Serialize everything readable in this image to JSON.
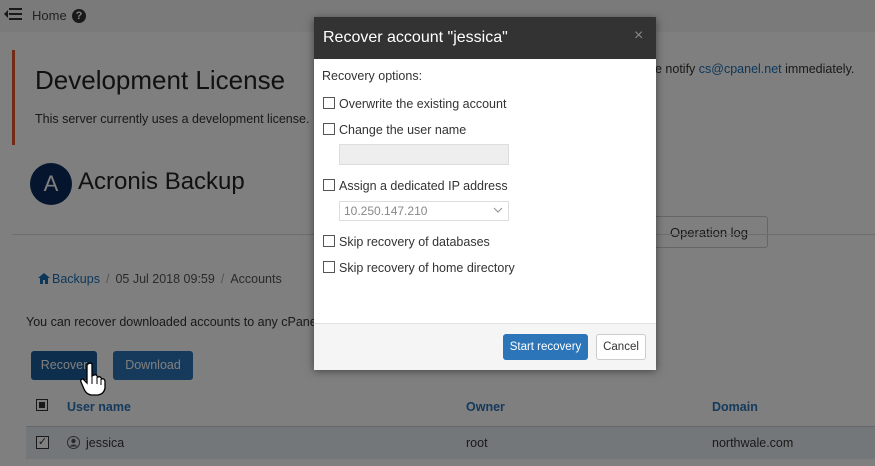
{
  "topbar": {
    "home_label": "Home",
    "help_glyph": "?"
  },
  "license": {
    "title": "Development License",
    "text_left": "This server currently uses a development license. I",
    "text_right_prefix": "e notify ",
    "email": "cs@cpanel.net",
    "text_right_suffix": " immediately."
  },
  "plugin": {
    "logo_letter": "A",
    "title": "Acronis Backup"
  },
  "toolbar": {
    "operation_log_label": "Operation log"
  },
  "breadcrumb": {
    "backups": "Backups",
    "date": "05 Jul 2018 09:59",
    "accounts": "Accounts"
  },
  "info_text": "You can recover downloaded accounts to any cPane",
  "actions": {
    "recover_label": "Recover",
    "download_label": "Download"
  },
  "table": {
    "headers": {
      "user": "User name",
      "owner": "Owner",
      "domain": "Domain"
    },
    "rows": [
      {
        "user": "jessica",
        "owner": "root",
        "domain": "northwale.com",
        "checked": "✓"
      }
    ]
  },
  "modal": {
    "title": "Recover account \"jessica\"",
    "close_glyph": "×",
    "options_label": "Recovery options:",
    "options": [
      "Overwrite the existing account",
      "Change the user name",
      "Assign a dedicated IP address",
      "Skip recovery of databases",
      "Skip recovery of home directory"
    ],
    "username_value": "",
    "ip_value": "10.250.147.210",
    "start_label": "Start recovery",
    "cancel_label": "Cancel"
  },
  "colors": {
    "primary": "#2c75b8",
    "dark_button": "#1b5c99",
    "accent_border": "#e4572e",
    "header_dark": "#333333",
    "overlay": "rgba(0,0,0,0.5)"
  }
}
